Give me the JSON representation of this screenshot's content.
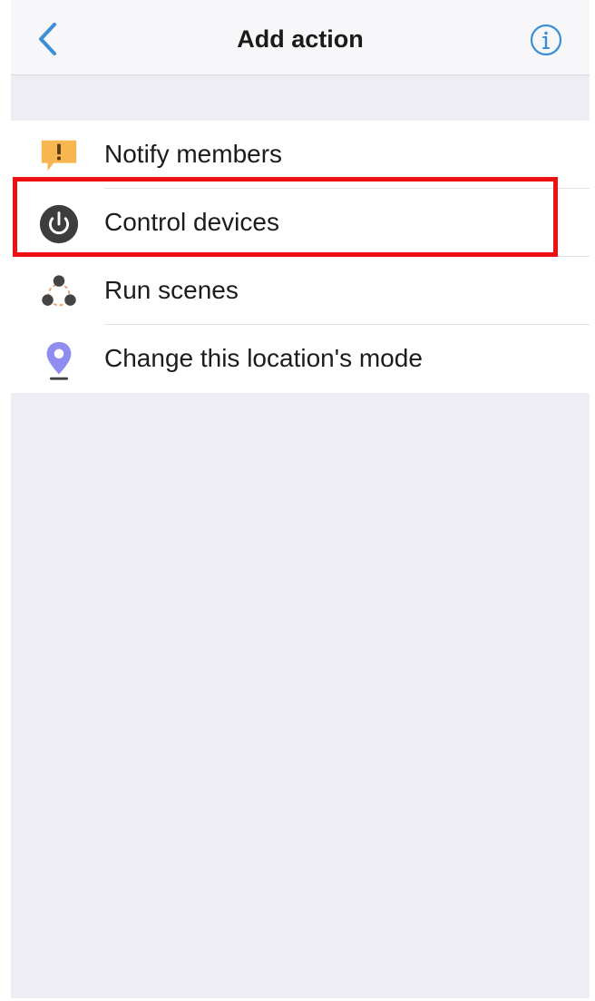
{
  "header": {
    "title": "Add action",
    "back_icon": "chevron-left-icon",
    "info_icon": "info-circle-icon"
  },
  "actions": [
    {
      "label": "Notify members",
      "icon": "notify-message-icon"
    },
    {
      "label": "Control devices",
      "icon": "power-icon"
    },
    {
      "label": "Run scenes",
      "icon": "scenes-icon"
    },
    {
      "label": "Change this location's mode",
      "icon": "location-pin-icon"
    }
  ],
  "highlighted_action": "Control devices",
  "colors": {
    "accent": "#3a8fd6",
    "highlight": "#ee1111",
    "notify": "#f7b650",
    "power": "#3d3d3d",
    "location": "#8f8ef0",
    "background": "#efedf4"
  }
}
